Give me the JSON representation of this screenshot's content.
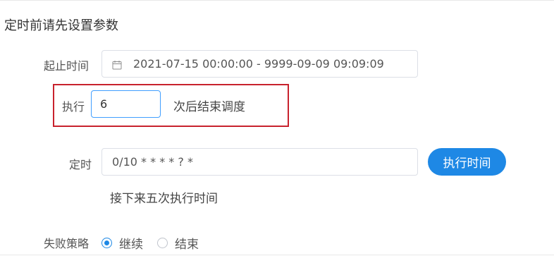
{
  "section": {
    "title": "定时前请先设置参数"
  },
  "range": {
    "label": "起止时间",
    "value": "2021-07-15 00:00:00 - 9999-09-09 09:09:09",
    "icon": "calendar-icon"
  },
  "execute": {
    "label": "执行",
    "value": "6",
    "suffix": "次后结束调度"
  },
  "schedule": {
    "label": "定时",
    "cron": "0/10 * * * * ? *",
    "button_label": "执行时间",
    "next_times_label": "接下来五次执行时间"
  },
  "failure": {
    "label": "失败策略",
    "options": [
      {
        "label": "继续",
        "selected": true
      },
      {
        "label": "结束",
        "selected": false
      }
    ]
  },
  "colors": {
    "primary": "#1e88e5",
    "highlight_border": "#c8222d",
    "focus_border": "#409eff"
  }
}
